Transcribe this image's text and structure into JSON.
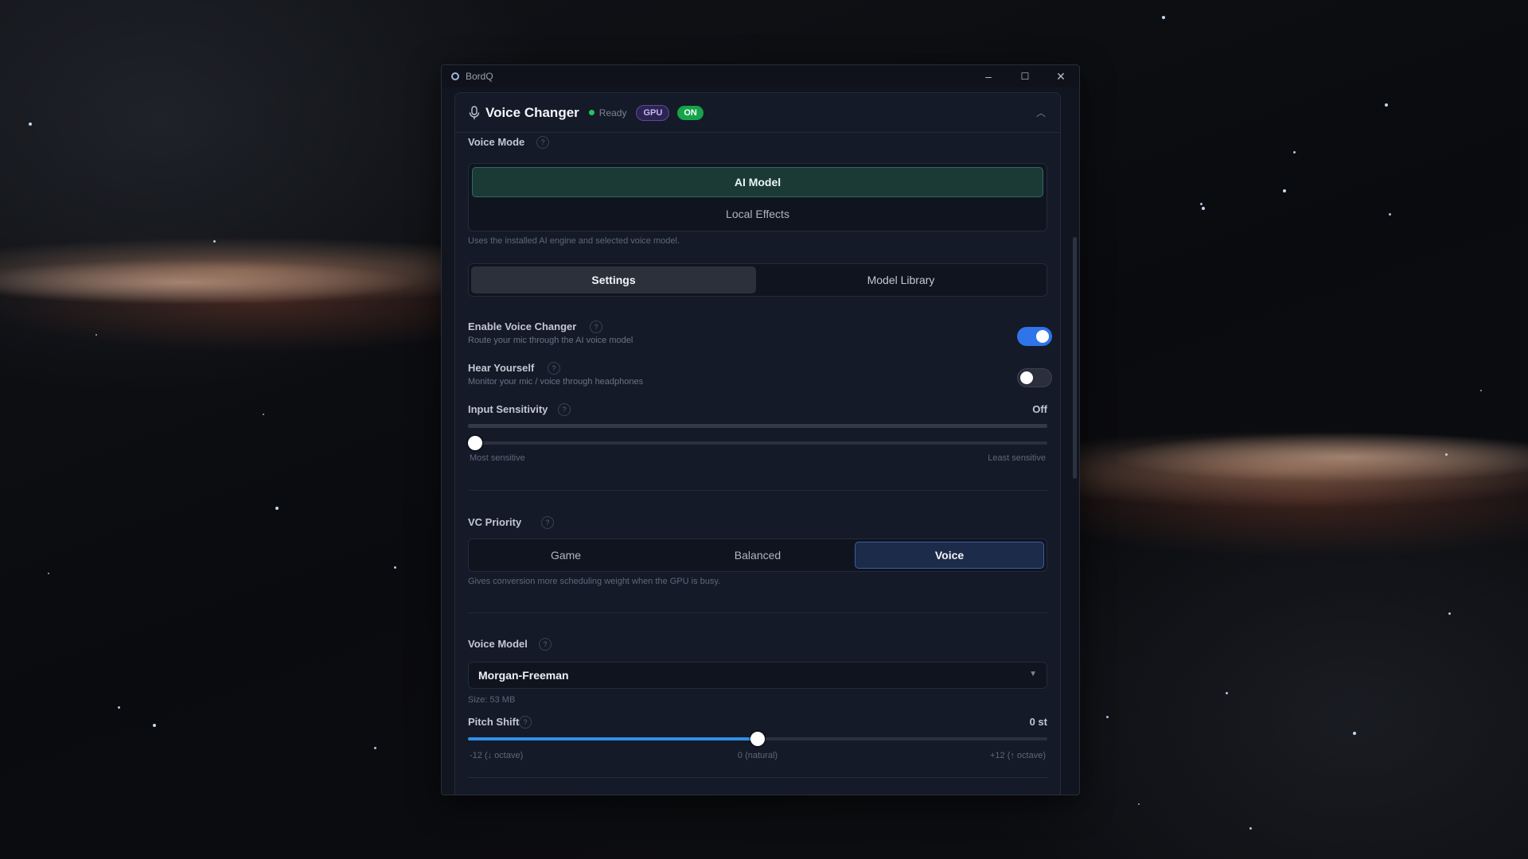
{
  "window": {
    "title": "BordQ",
    "minimize": "–",
    "maximize": "☐",
    "close": "✕"
  },
  "header": {
    "title": "Voice Changer",
    "status": "Ready",
    "badge_gpu": "GPU",
    "badge_on": "ON",
    "collapse": "︿"
  },
  "voice_mode": {
    "label": "Voice Mode",
    "options": [
      "AI Model",
      "Local Effects"
    ],
    "selected": "AI Model",
    "hint": "Uses the installed AI engine and selected voice model."
  },
  "tabs": {
    "items": [
      "Settings",
      "Model Library"
    ],
    "selected": "Settings"
  },
  "enable_vc": {
    "label": "Enable Voice Changer",
    "sub": "Route your mic through the AI voice model",
    "on": true
  },
  "hear_yourself": {
    "label": "Hear Yourself",
    "sub": "Monitor your mic / voice through headphones",
    "on": false
  },
  "input_sensitivity": {
    "label": "Input Sensitivity",
    "value_text": "Off",
    "level": 0,
    "min_label": "Most sensitive",
    "max_label": "Least sensitive"
  },
  "vc_priority": {
    "label": "VC Priority",
    "options": [
      "Game",
      "Balanced",
      "Voice"
    ],
    "selected": "Voice",
    "hint": "Gives conversion more scheduling weight when the GPU is busy."
  },
  "voice_model": {
    "label": "Voice Model",
    "value": "Morgan-Freeman",
    "size": "Size: 53 MB"
  },
  "pitch_shift": {
    "label": "Pitch Shift",
    "value_text": "0 st",
    "value": 0,
    "min": -12,
    "max": 12,
    "min_label": "-12 (↓ octave)",
    "mid_label": "0 (natural)",
    "max_label": "+12 (↑ octave)"
  },
  "colors": {
    "accent_blue": "#2f74e8",
    "ready_green": "#22c55e",
    "ai_model_bg": "#1b3a36",
    "gpu_purple": "#c4b5fd"
  }
}
